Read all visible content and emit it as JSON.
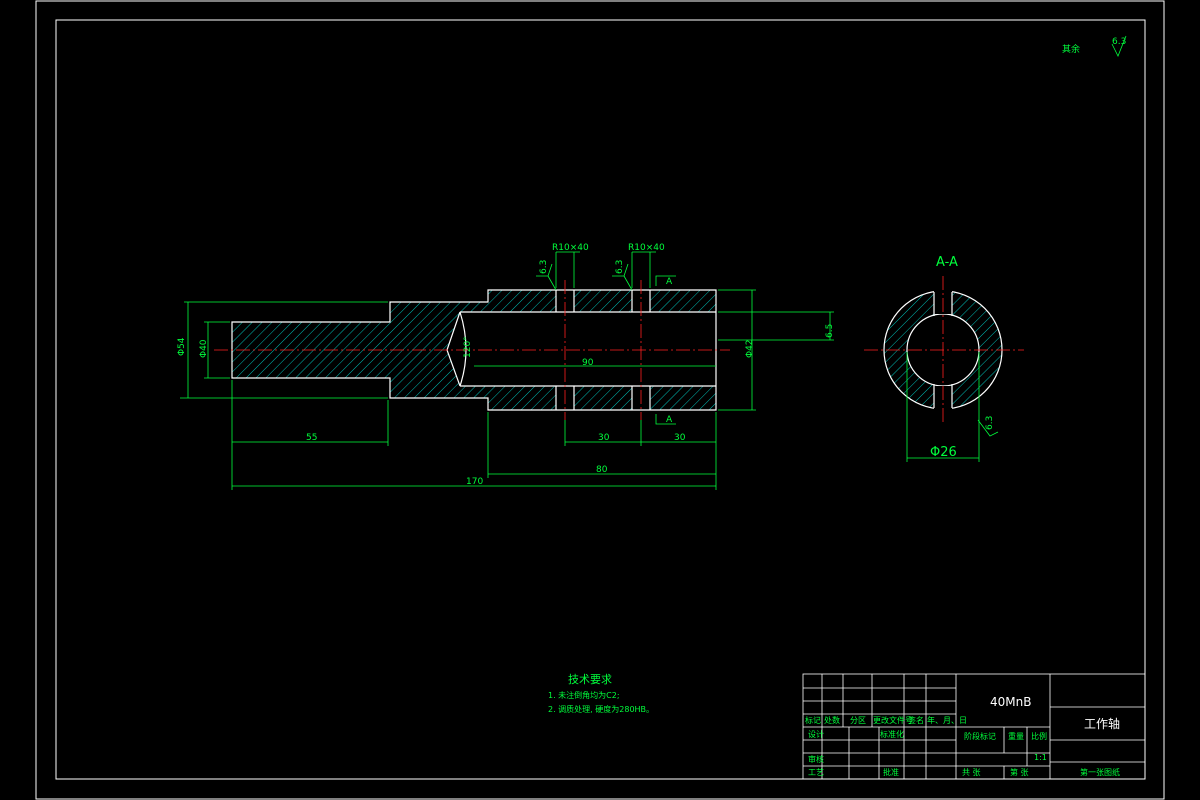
{
  "roughness_note": {
    "text": "其余",
    "value": "6.3"
  },
  "section_label": "A-A",
  "view_arrow_label": "A",
  "main_view": {
    "dims": {
      "dia_left_outer": "Φ54",
      "dia_left_inner": "Φ40",
      "dia_right": "Φ42",
      "len_55": "55",
      "len_170": "170",
      "len_80": "80",
      "len_90": "90",
      "len_30a": "30",
      "len_30b": "30",
      "slot_1": "R10×40",
      "slot_2": "R10×40",
      "rough_1": "6.3",
      "rough_2": "6.3",
      "depth": "6.5",
      "drill_angle": "120°"
    }
  },
  "section_view": {
    "dia": "Φ26",
    "rough": "6.3"
  },
  "tech_requirements": {
    "title": "技术要求",
    "items": [
      "1. 未注倒角均为C2;",
      "2. 调质处理, 硬度为280HB。"
    ]
  },
  "title_block": {
    "material": "40MnB",
    "part_name": "工作轴",
    "headers": [
      "标记",
      "处数",
      "分区",
      "更改文件号",
      "签名",
      "年、月、日"
    ],
    "left_labels": [
      "设计",
      "审核",
      "工艺"
    ],
    "std_label": "标准化",
    "approve_label": "批准",
    "stage_label": "阶段标记",
    "weight_label": "重量",
    "scale_label": "比例",
    "scale_value": "1:1",
    "sheet_total": "共  张",
    "sheet_num": "第  张",
    "drawing_no": "第一张图纸"
  }
}
